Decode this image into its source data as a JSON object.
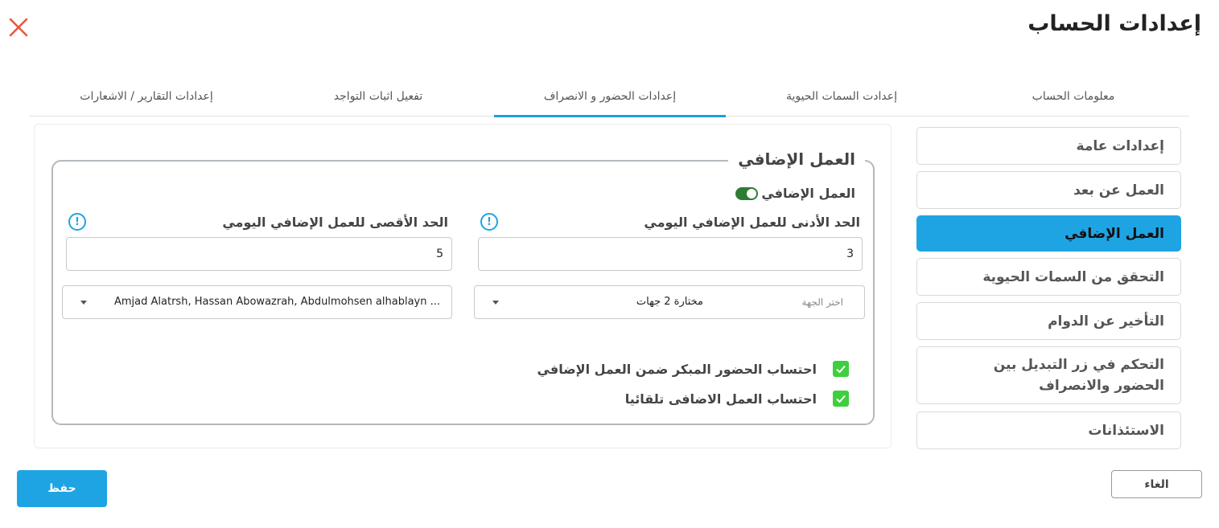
{
  "header": {
    "title": "إعدادات الحساب",
    "close_icon": "close-icon"
  },
  "tabs": [
    {
      "label": "معلومات الحساب",
      "active": false
    },
    {
      "label": "إعدادت السمات الحيوية",
      "active": false
    },
    {
      "label": "إعدادات الحضور و الانصراف",
      "active": true
    },
    {
      "label": "تفعيل اثبات التواجد",
      "active": false
    },
    {
      "label": "إعدادات التقارير / الاشعارات",
      "active": false
    }
  ],
  "sidebar": {
    "items": [
      {
        "label": "إعدادات عامة",
        "active": false
      },
      {
        "label": "العمل عن بعد",
        "active": false
      },
      {
        "label": "العمل الإضافي",
        "active": true
      },
      {
        "label": "التحقق من السمات الحيوية",
        "active": false
      },
      {
        "label": "التأخير عن الدوام",
        "active": false
      },
      {
        "label": "التحكم في زر التبديل بين الحضور والانصراف",
        "active": false
      },
      {
        "label": "الاستئذانات",
        "active": false
      }
    ]
  },
  "overtime": {
    "legend": "العمل الإضافي",
    "toggle_label": "العمل الإضافي",
    "toggle_on": true,
    "min_label": "الحد الأدنى للعمل الإضافي اليومي",
    "min_value": "3",
    "max_label": "الحد الأقصى للعمل الإضافي اليومي",
    "max_value": "5",
    "info_glyph": "!",
    "dept_select": {
      "placeholder": "اختر الجهة",
      "value": "مختارة 2 جهات"
    },
    "users_select": {
      "value": "Amjad Alatrsh, Hassan Abowazrah, Abdulmohsen alhablayn ..."
    },
    "checks": [
      {
        "label": "احتساب الحضور المبكر ضمن العمل الإضافي",
        "checked": true
      },
      {
        "label": "احتساب العمل الاضافى تلقائيا",
        "checked": true
      }
    ]
  },
  "footer": {
    "save_label": "حفظ",
    "cancel_label": "الغاء"
  },
  "colors": {
    "accent": "#1fa4e3",
    "close": "#e8573f",
    "toggle": "#2e7d32",
    "check": "#3ecf3e"
  }
}
